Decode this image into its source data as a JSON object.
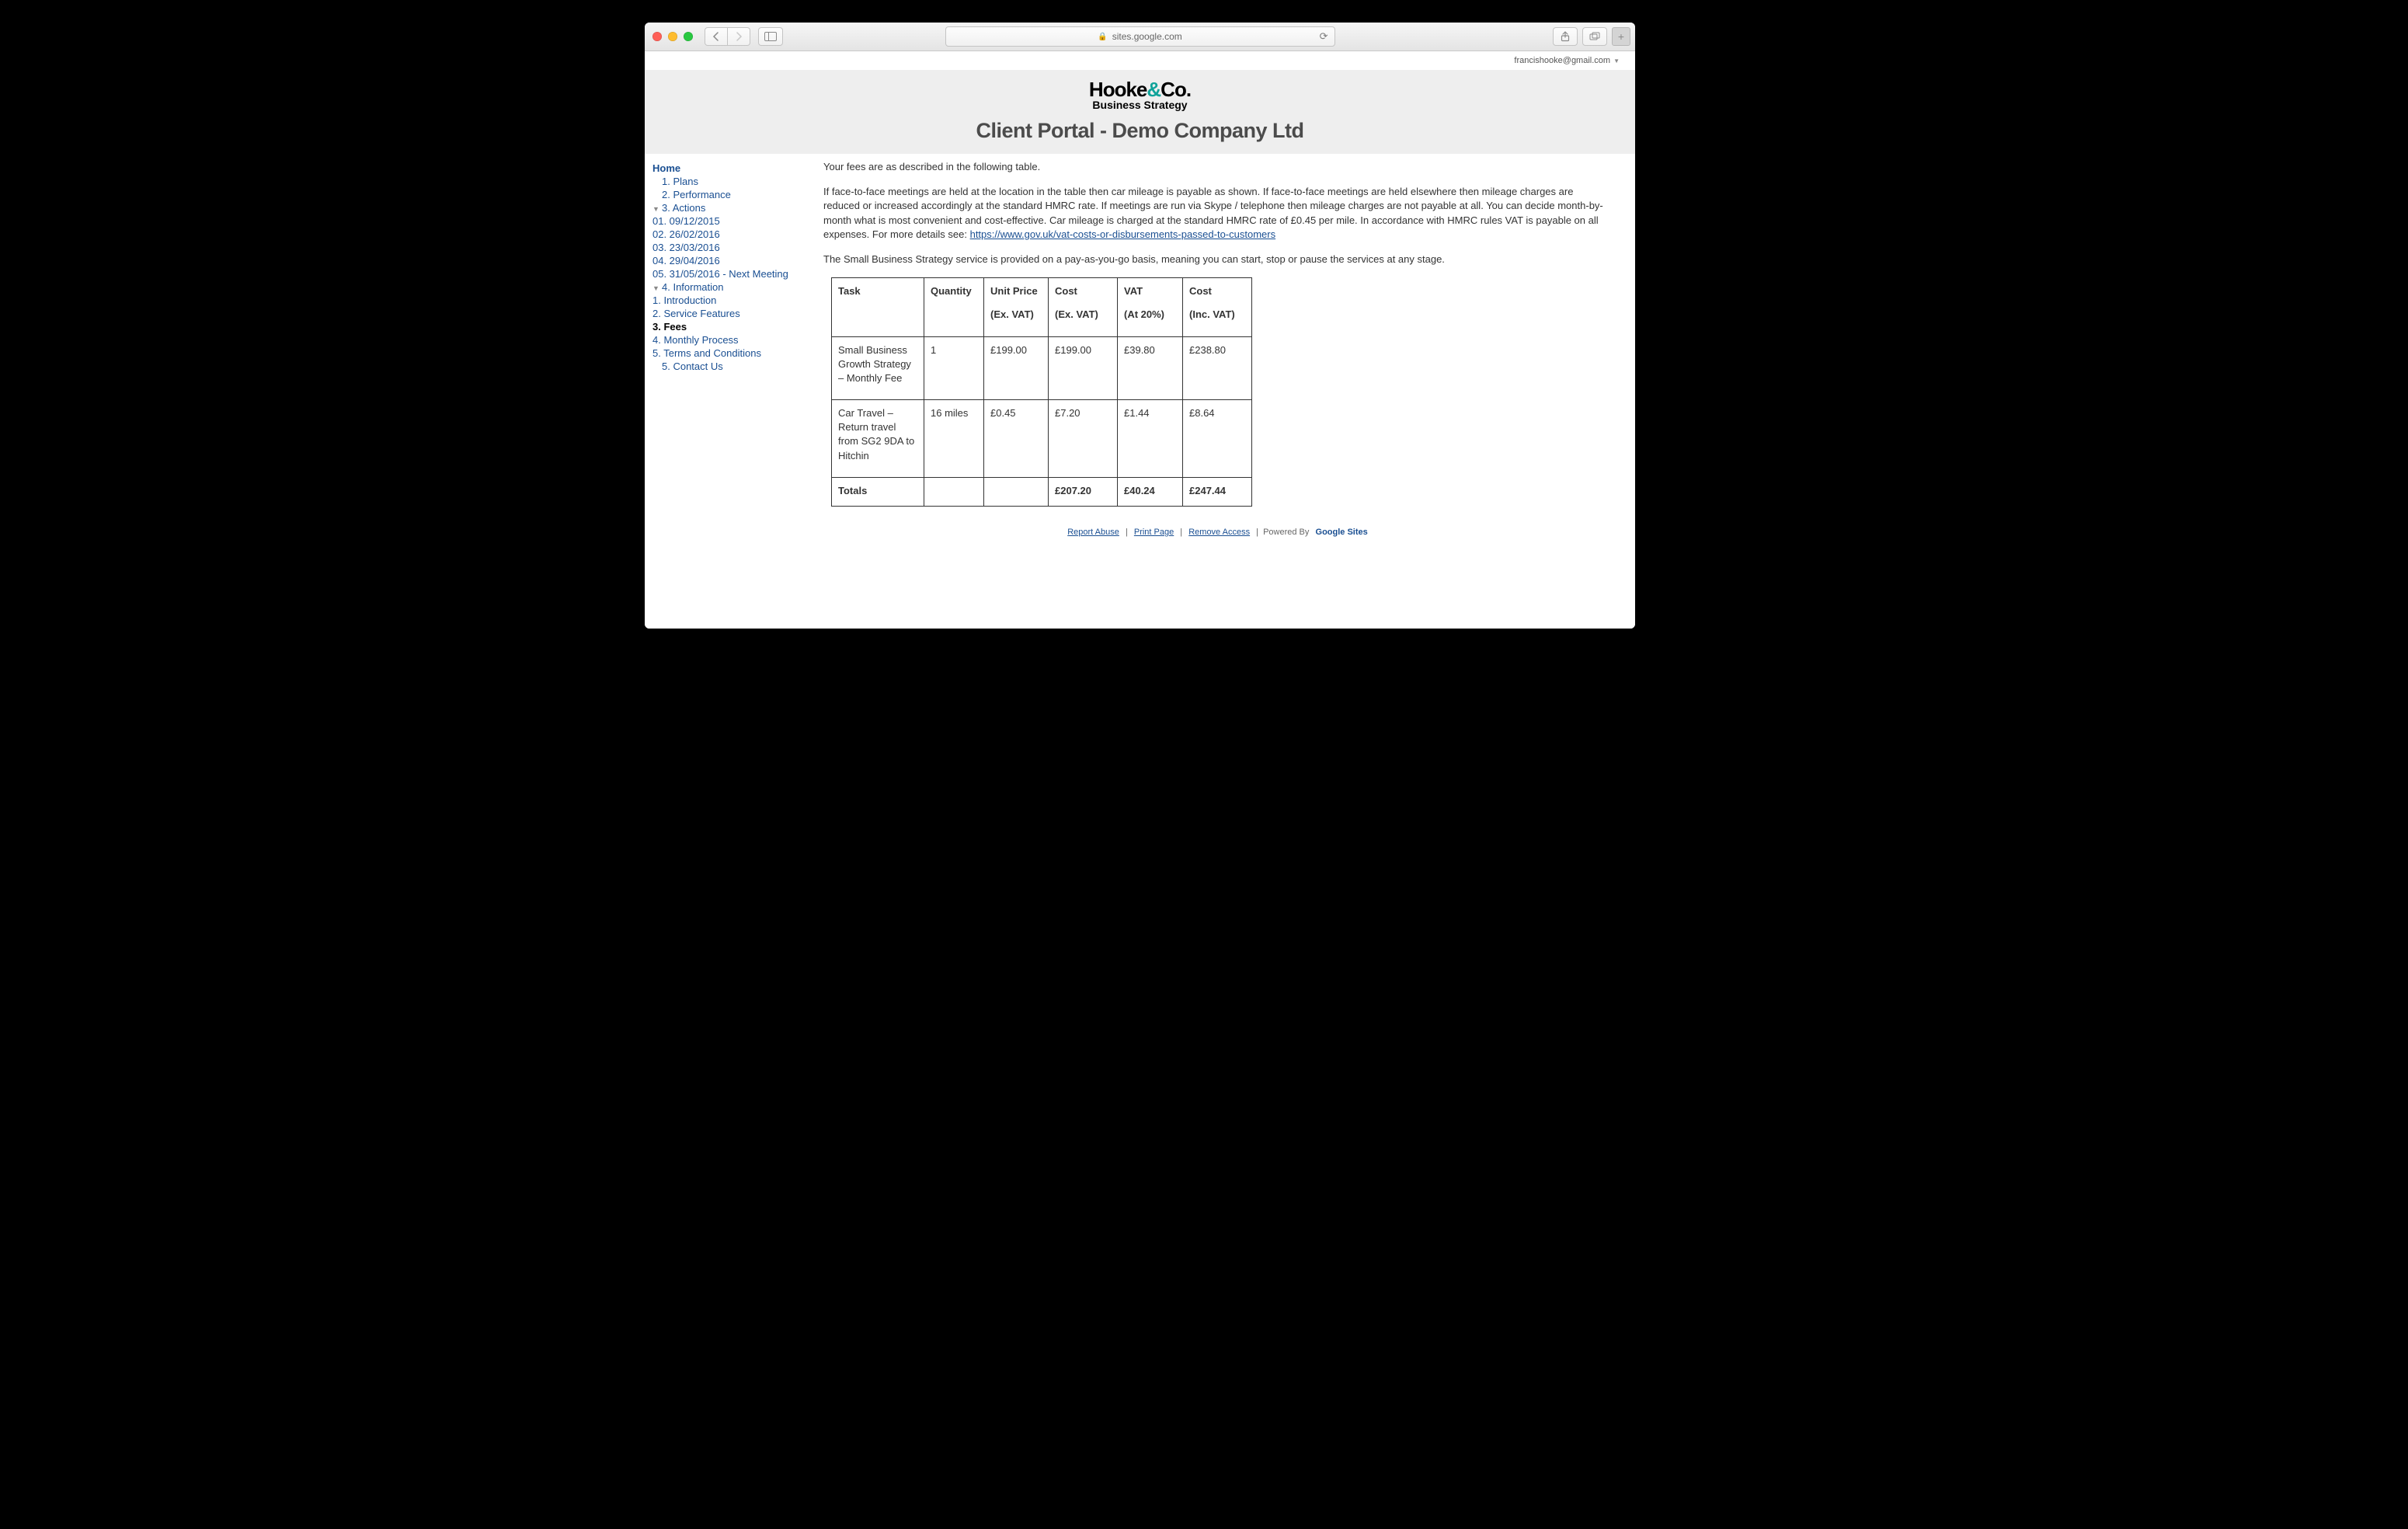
{
  "browser": {
    "address": "sites.google.com"
  },
  "user": {
    "email": "francishooke@gmail.com"
  },
  "logo": {
    "line1_a": "Hooke",
    "line1_b": "&",
    "line1_c": "Co.",
    "line2": "Business Strategy"
  },
  "portal_title": "Client Portal - Demo Company Ltd",
  "nav": {
    "home": "Home",
    "plans": "1. Plans",
    "performance": "2. Performance",
    "actions": "3. Actions",
    "actions_children": {
      "a1": "01. 09/12/2015",
      "a2": "02. 26/02/2016",
      "a3": "03. 23/03/2016",
      "a4": "04. 29/04/2016",
      "a5": "05. 31/05/2016 - Next Meeting"
    },
    "information": "4. Information",
    "information_children": {
      "intro": "1. Introduction",
      "features": "2. Service Features",
      "fees": "3. Fees",
      "monthly": "4. Monthly Process",
      "terms": "5. Terms and Conditions"
    },
    "contact": "5. Contact Us"
  },
  "content": {
    "p1": "Your fees are as described in the following table.",
    "p2_a": "If face-to-face meetings are held at the location in the table then car mileage is payable as shown. If face-to-face meetings are held elsewhere then mileage charges are reduced or increased accordingly at the standard HMRC rate. If meetings are run via Skype / telephone then mileage charges are not payable at all. You can decide month-by-month what is most convenient and cost-effective. Car mileage is charged at the standard HMRC rate of £0.45 per mile. In accordance with HMRC rules VAT is payable on all expenses. For more details see: ",
    "p2_link": "https://www.gov.uk/vat-costs-or-disbursements-passed-to-customers",
    "p3": "The Small Business Strategy service is provided on a pay-as-you-go basis, meaning you can start, stop or pause the services at any stage."
  },
  "table": {
    "headers": {
      "task": "Task",
      "qty": "Quantity",
      "unit_price": "Unit Price",
      "unit_price_sub": "(Ex. VAT)",
      "cost_ex": "Cost",
      "cost_ex_sub": "(Ex. VAT)",
      "vat": "VAT",
      "vat_sub": "(At 20%)",
      "cost_inc": "Cost",
      "cost_inc_sub": "(Inc. VAT)"
    },
    "row1": {
      "task": "Small Business Growth Strategy – Monthly Fee",
      "qty": "1",
      "unit_price": "£199.00",
      "cost_ex": "£199.00",
      "vat": "£39.80",
      "cost_inc": "£238.80"
    },
    "row2": {
      "task": "Car Travel – Return travel from SG2 9DA to Hitchin",
      "qty": "16 miles",
      "unit_price": "£0.45",
      "cost_ex": "£7.20",
      "vat": "£1.44",
      "cost_inc": "£8.64"
    },
    "totals": {
      "label": "Totals",
      "cost_ex": "£207.20",
      "vat": "£40.24",
      "cost_inc": "£247.44"
    }
  },
  "footer": {
    "report": "Report Abuse",
    "print": "Print Page",
    "remove": "Remove Access",
    "powered": "Powered By",
    "gsites": "Google Sites"
  }
}
